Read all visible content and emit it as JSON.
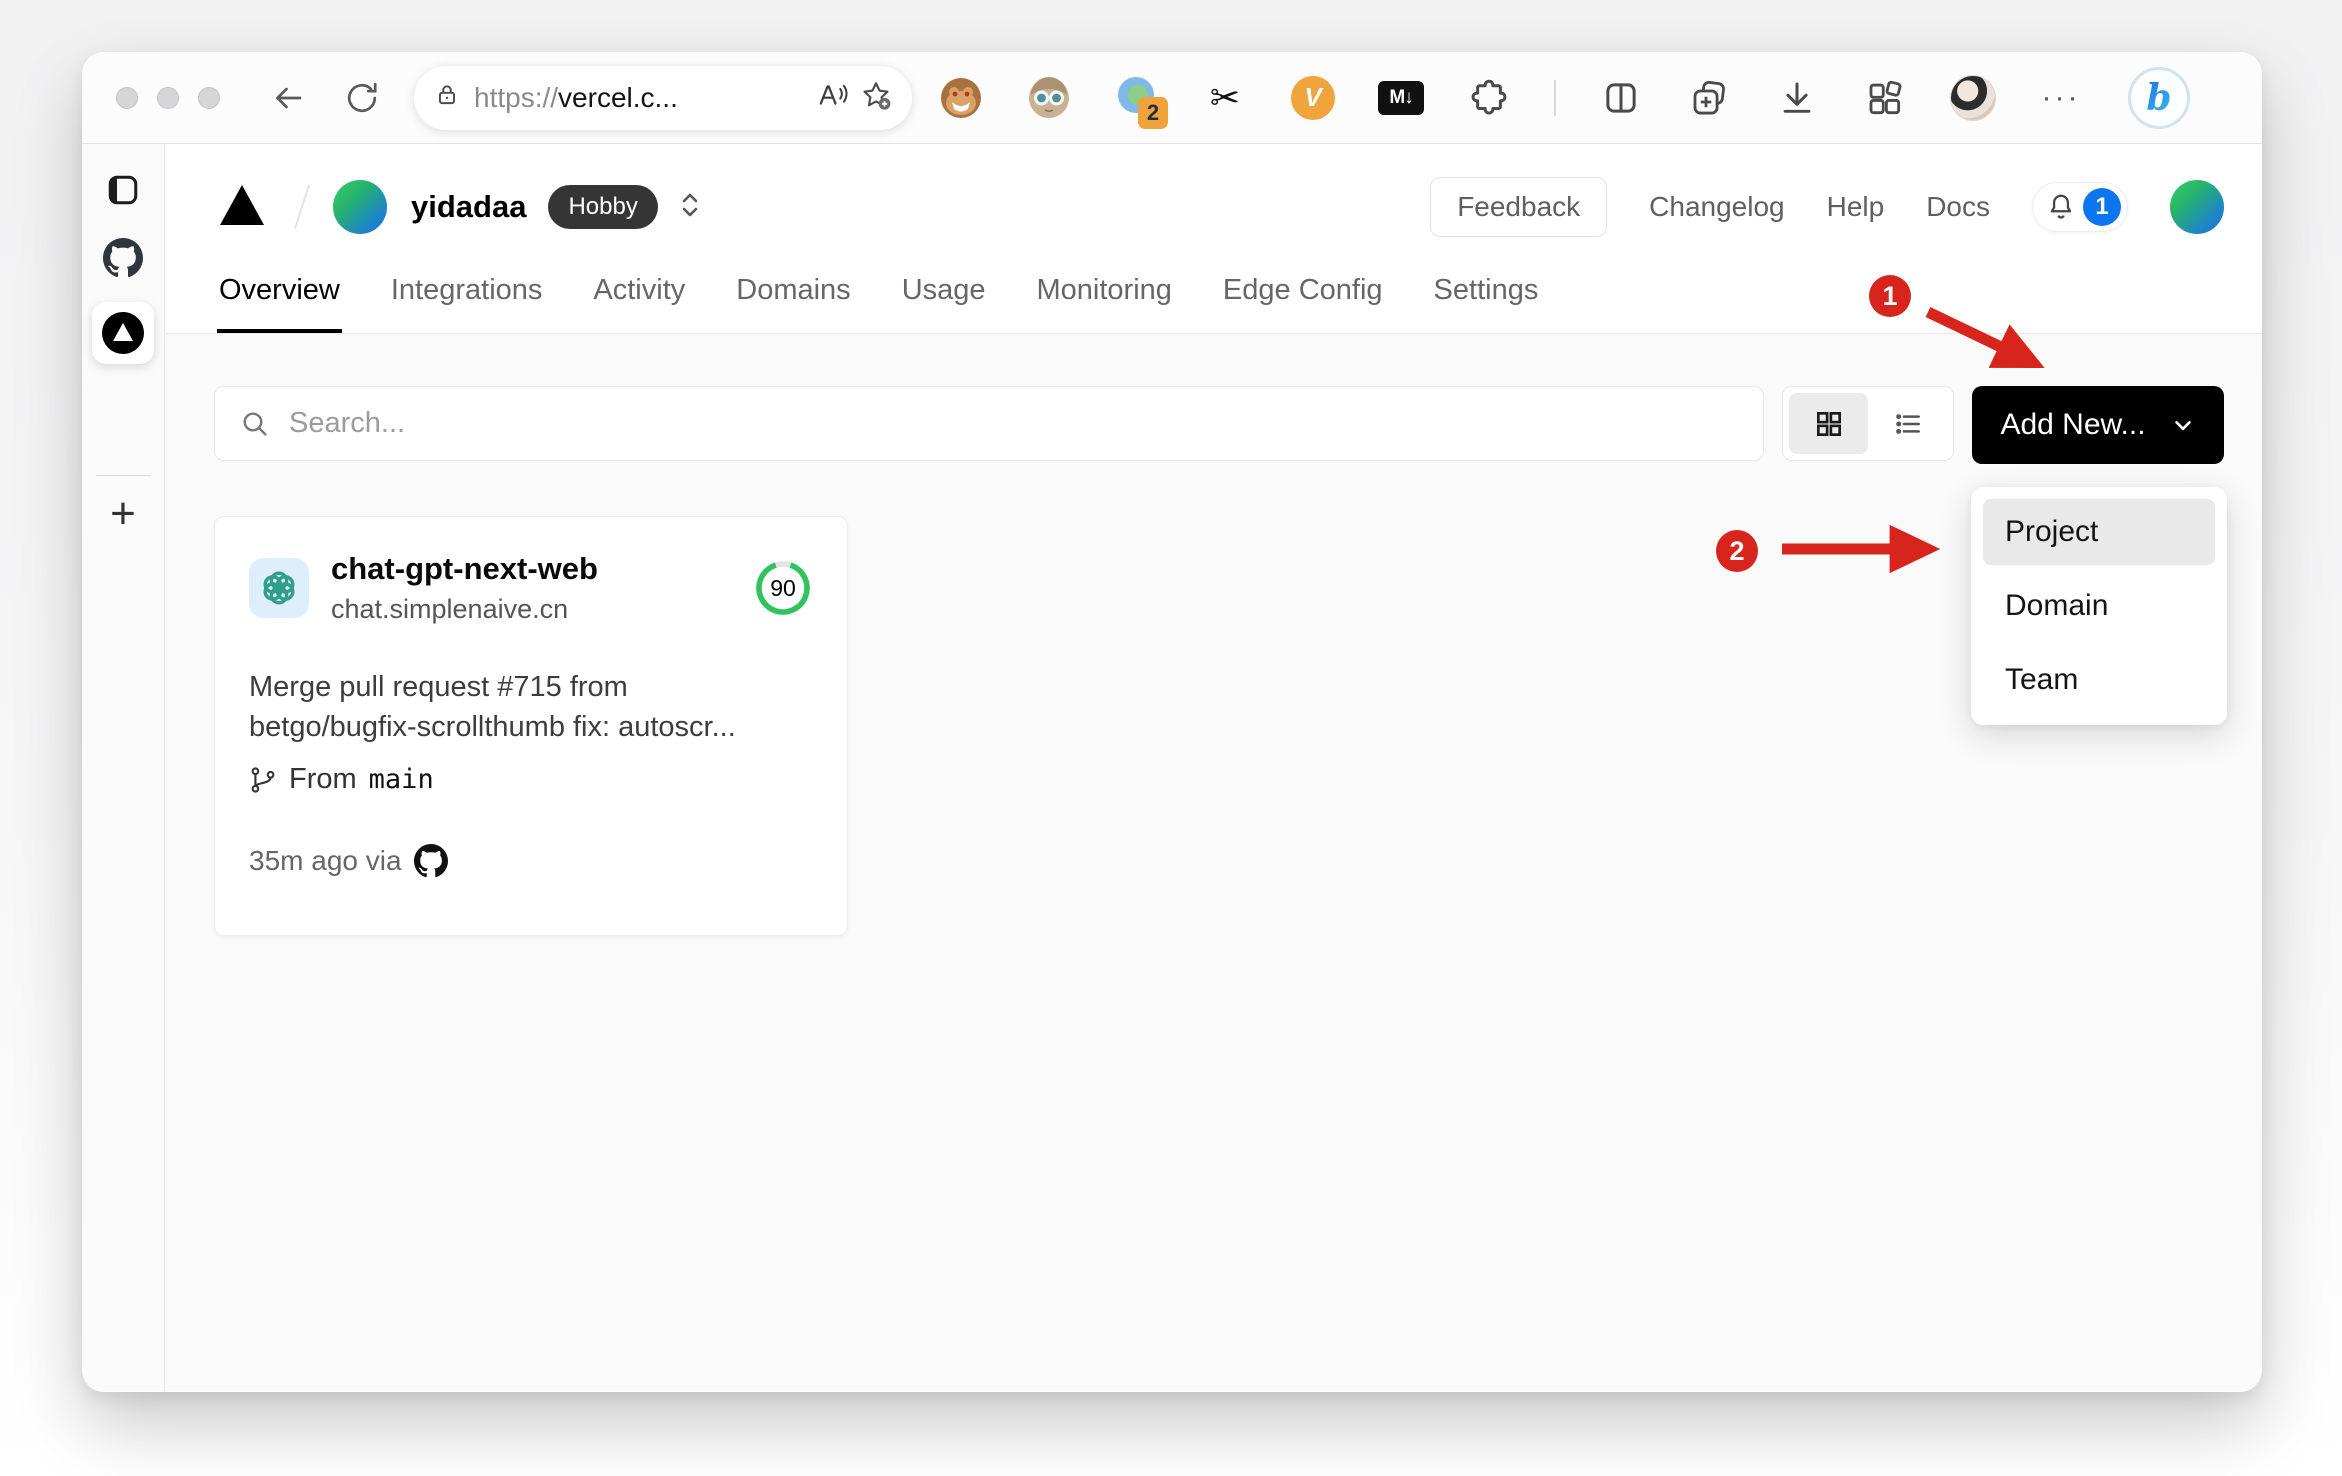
{
  "browser": {
    "url_scheme": "https://",
    "url_host": "vercel.c...",
    "extension_badge_count": "2",
    "markdown_ext_label": "M↓",
    "v_ext_label": "V"
  },
  "icons": {
    "scissors": "✂",
    "more": "···",
    "new_tab_plus": "+",
    "bing_letter": "b"
  },
  "header": {
    "team_name": "yidadaa",
    "plan_badge": "Hobby",
    "feedback_label": "Feedback",
    "nav": [
      "Changelog",
      "Help",
      "Docs"
    ],
    "notification_count": "1"
  },
  "tabs": [
    "Overview",
    "Integrations",
    "Activity",
    "Domains",
    "Usage",
    "Monitoring",
    "Edge Config",
    "Settings"
  ],
  "controls": {
    "search_placeholder": "Search...",
    "add_new_label": "Add New..."
  },
  "dropdown": {
    "items": [
      "Project",
      "Domain",
      "Team"
    ]
  },
  "project_card": {
    "name": "chat-gpt-next-web",
    "domain": "chat.simplenaive.cn",
    "score": "90",
    "commit_message": "Merge pull request #715 from betgo/bugfix-scrollthumb fix: autoscr...",
    "branch_label": "From",
    "branch_name": "main",
    "deployed": "35m ago via"
  },
  "annotations": {
    "step1": "1",
    "step2": "2"
  },
  "colors": {
    "score_green": "#2fc45f",
    "notification_blue": "#0b76ef",
    "annotation_red": "#d7251d",
    "openai_teal": "#2f9e8a",
    "openai_bg": "#ddeffa",
    "accent_black": "#000000"
  }
}
